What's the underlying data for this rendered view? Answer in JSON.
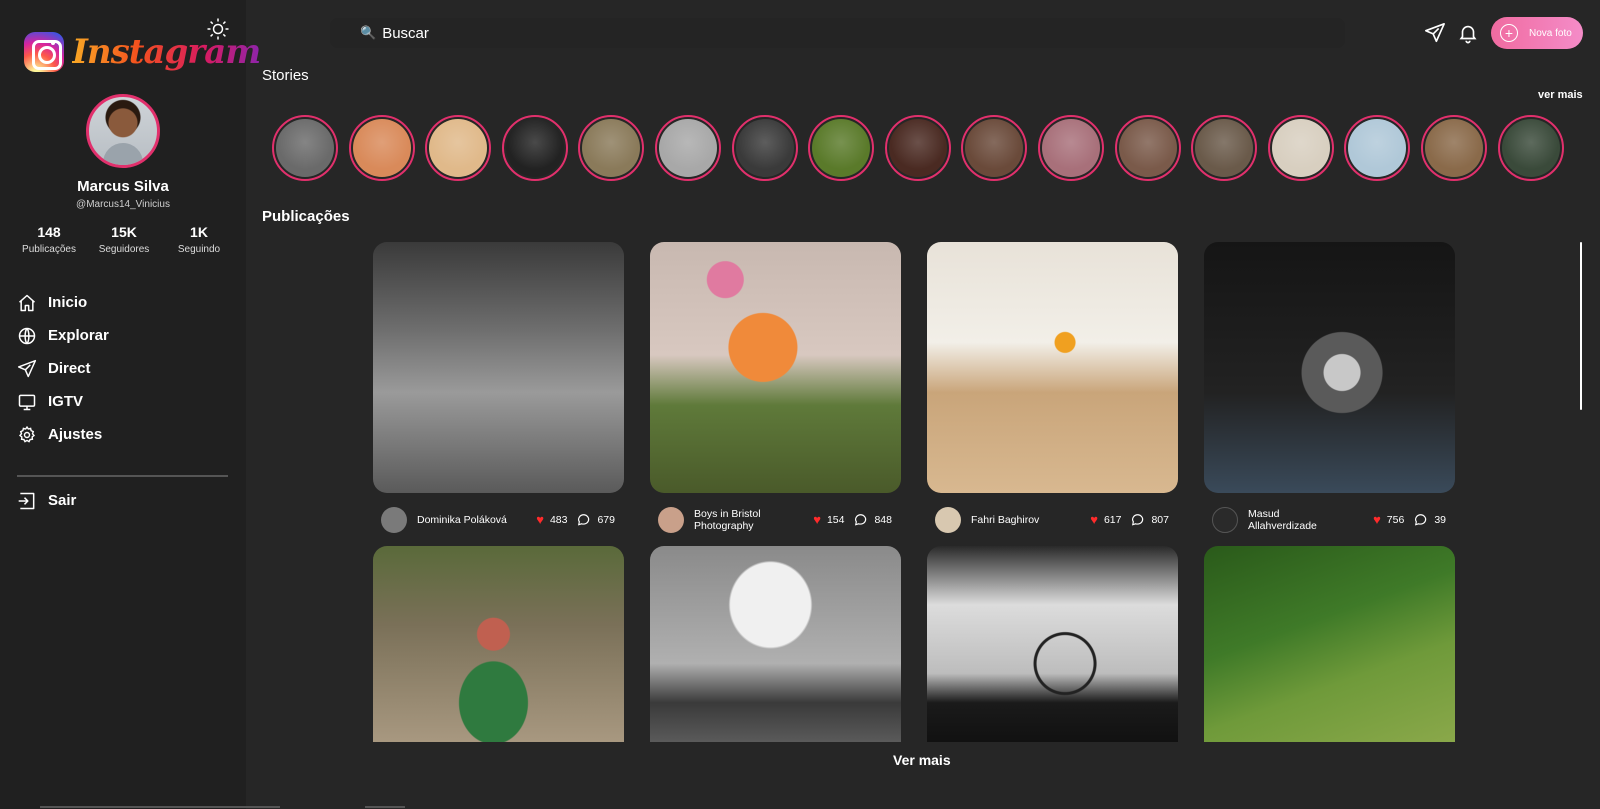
{
  "brand": {
    "name": "Instagram",
    "icon": "instagram-logo-icon"
  },
  "theme_toggle": {
    "icon": "sun-icon"
  },
  "profile": {
    "name": "Marcus Silva",
    "handle": "@Marcus14_Vinicius",
    "stats": [
      {
        "value": "148",
        "label": "Publicações"
      },
      {
        "value": "15K",
        "label": "Seguidores"
      },
      {
        "value": "1K",
        "label": "Seguindo"
      }
    ]
  },
  "nav": {
    "items": [
      {
        "label": "Inicio",
        "icon": "home-icon"
      },
      {
        "label": "Explorar",
        "icon": "globe-icon"
      },
      {
        "label": "Direct",
        "icon": "send-icon"
      },
      {
        "label": "IGTV",
        "icon": "monitor-icon"
      },
      {
        "label": "Ajustes",
        "icon": "gear-icon"
      }
    ],
    "logout_label": "Sair"
  },
  "search": {
    "placeholder": "Buscar",
    "icon": "search-icon"
  },
  "topbar": {
    "new_photo_label": "Nova foto",
    "icons": [
      "send-icon",
      "bell-icon",
      "plus-circle-icon"
    ]
  },
  "stories": {
    "title": "Stories",
    "see_more": "ver mais",
    "colors": [
      "#6a6a6a",
      "#d98a5a",
      "#e0b98a",
      "#222222",
      "#8a7a5a",
      "#a8a8a8",
      "#3a3a3a",
      "#5a7a2a",
      "#4a2a22",
      "#6a4a3a",
      "#a8707a",
      "#7a5a4a",
      "#6a5a4a",
      "#d8cfc0",
      "#b0c8d8",
      "#8a6a4a",
      "#3a4a3a"
    ]
  },
  "publications": {
    "title": "Publicações",
    "posts": [
      {
        "author": "Dominika Poláková",
        "likes": "483",
        "comments": "679"
      },
      {
        "author": "Boys in Bristol Photography",
        "likes": "154",
        "comments": "848"
      },
      {
        "author": "Fahri Baghirov",
        "likes": "617",
        "comments": "807"
      },
      {
        "author": "Masud Allahverdizade",
        "likes": "756",
        "comments": "39"
      }
    ],
    "see_more": "Ver mais"
  },
  "colors": {
    "background": "#262626",
    "sidebar": "#202020",
    "accent": "#e1306c",
    "like": "#ff2b2b"
  }
}
